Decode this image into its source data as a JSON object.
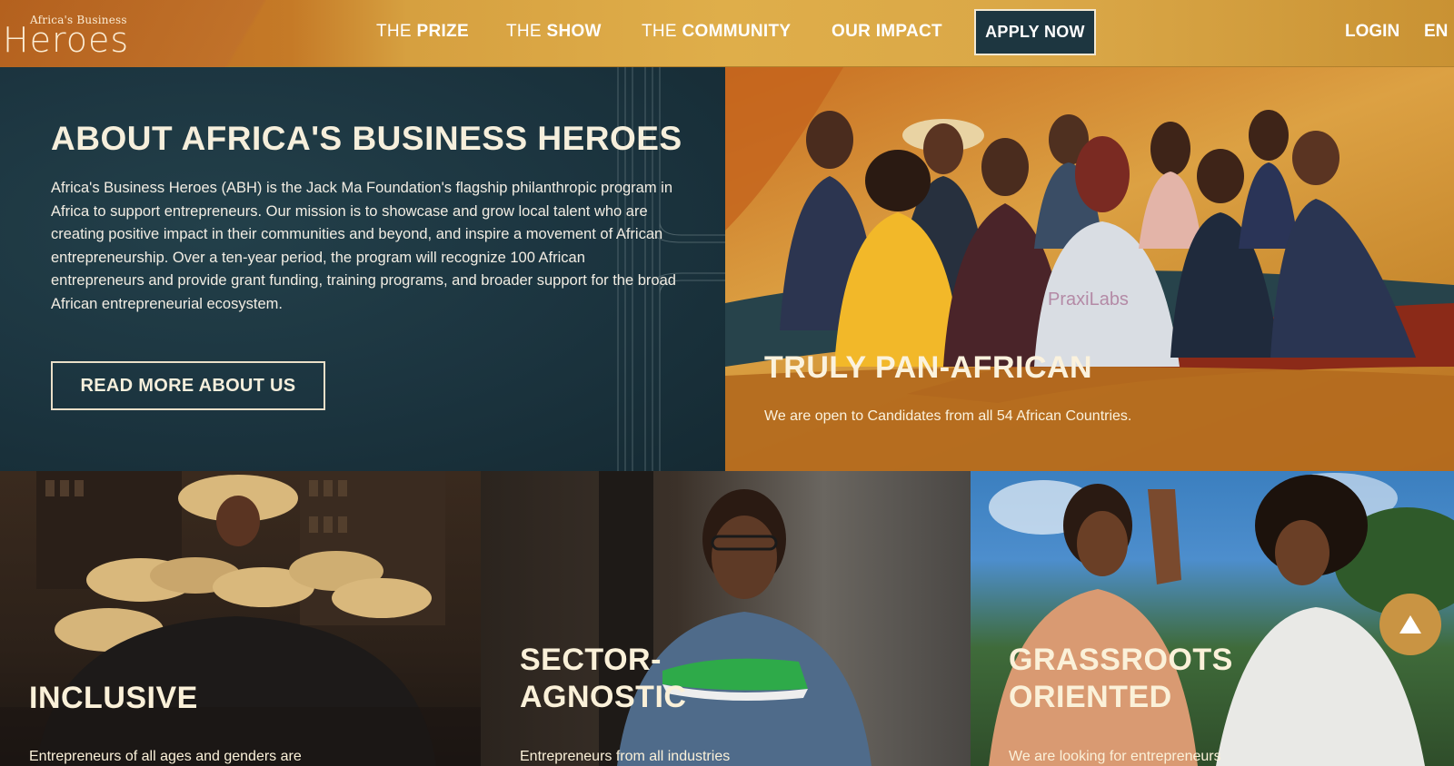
{
  "header": {
    "logo_small": "Africa's Business",
    "logo_big": "Heroes",
    "nav": [
      {
        "pre": "THE ",
        "bold": "PRIZE"
      },
      {
        "pre": "THE ",
        "bold": "SHOW"
      },
      {
        "pre": "THE ",
        "bold": "COMMUNITY"
      },
      {
        "pre": "",
        "bold": "OUR IMPACT"
      }
    ],
    "apply_label": "APPLY NOW",
    "login_label": "LOGIN",
    "lang_label": "EN"
  },
  "about": {
    "title": "ABOUT AFRICA'S BUSINESS HEROES",
    "text": "Africa's Business Heroes (ABH) is the Jack Ma Foundation's flagship philanthropic program in Africa to support entrepreneurs. Our mission is to showcase and grow local talent who are creating positive impact in their communities and beyond, and inspire a movement of African entrepreneurship. Over a ten-year period, the program will recognize 100 African entrepreneurs and provide grant funding, training programs, and broader support for the broad African entrepreneurial ecosystem.",
    "button_label": "READ MORE ABOUT US"
  },
  "pan_african": {
    "title": "TRULY PAN-AFRICAN",
    "text": "We are open to Candidates from all 54 African Countries.",
    "shirt_brand": "PraxiLabs"
  },
  "cards": [
    {
      "title_line1": "INCLUSIVE",
      "title_line2": "",
      "text": "Entrepreneurs of all ages and genders are"
    },
    {
      "title_line1": "SECTOR-",
      "title_line2": "AGNOSTIC",
      "text": "Entrepreneurs from all industries"
    },
    {
      "title_line1": "GRASSROOTS",
      "title_line2": "ORIENTED",
      "text": "We are looking for entrepreneurs"
    }
  ],
  "colors": {
    "header_gold": "#dca143",
    "navy": "#1d3640",
    "cream": "#f6efdc",
    "scroll_button": "#c99443"
  },
  "icons": {
    "scroll_top": "triangle-up-icon"
  }
}
